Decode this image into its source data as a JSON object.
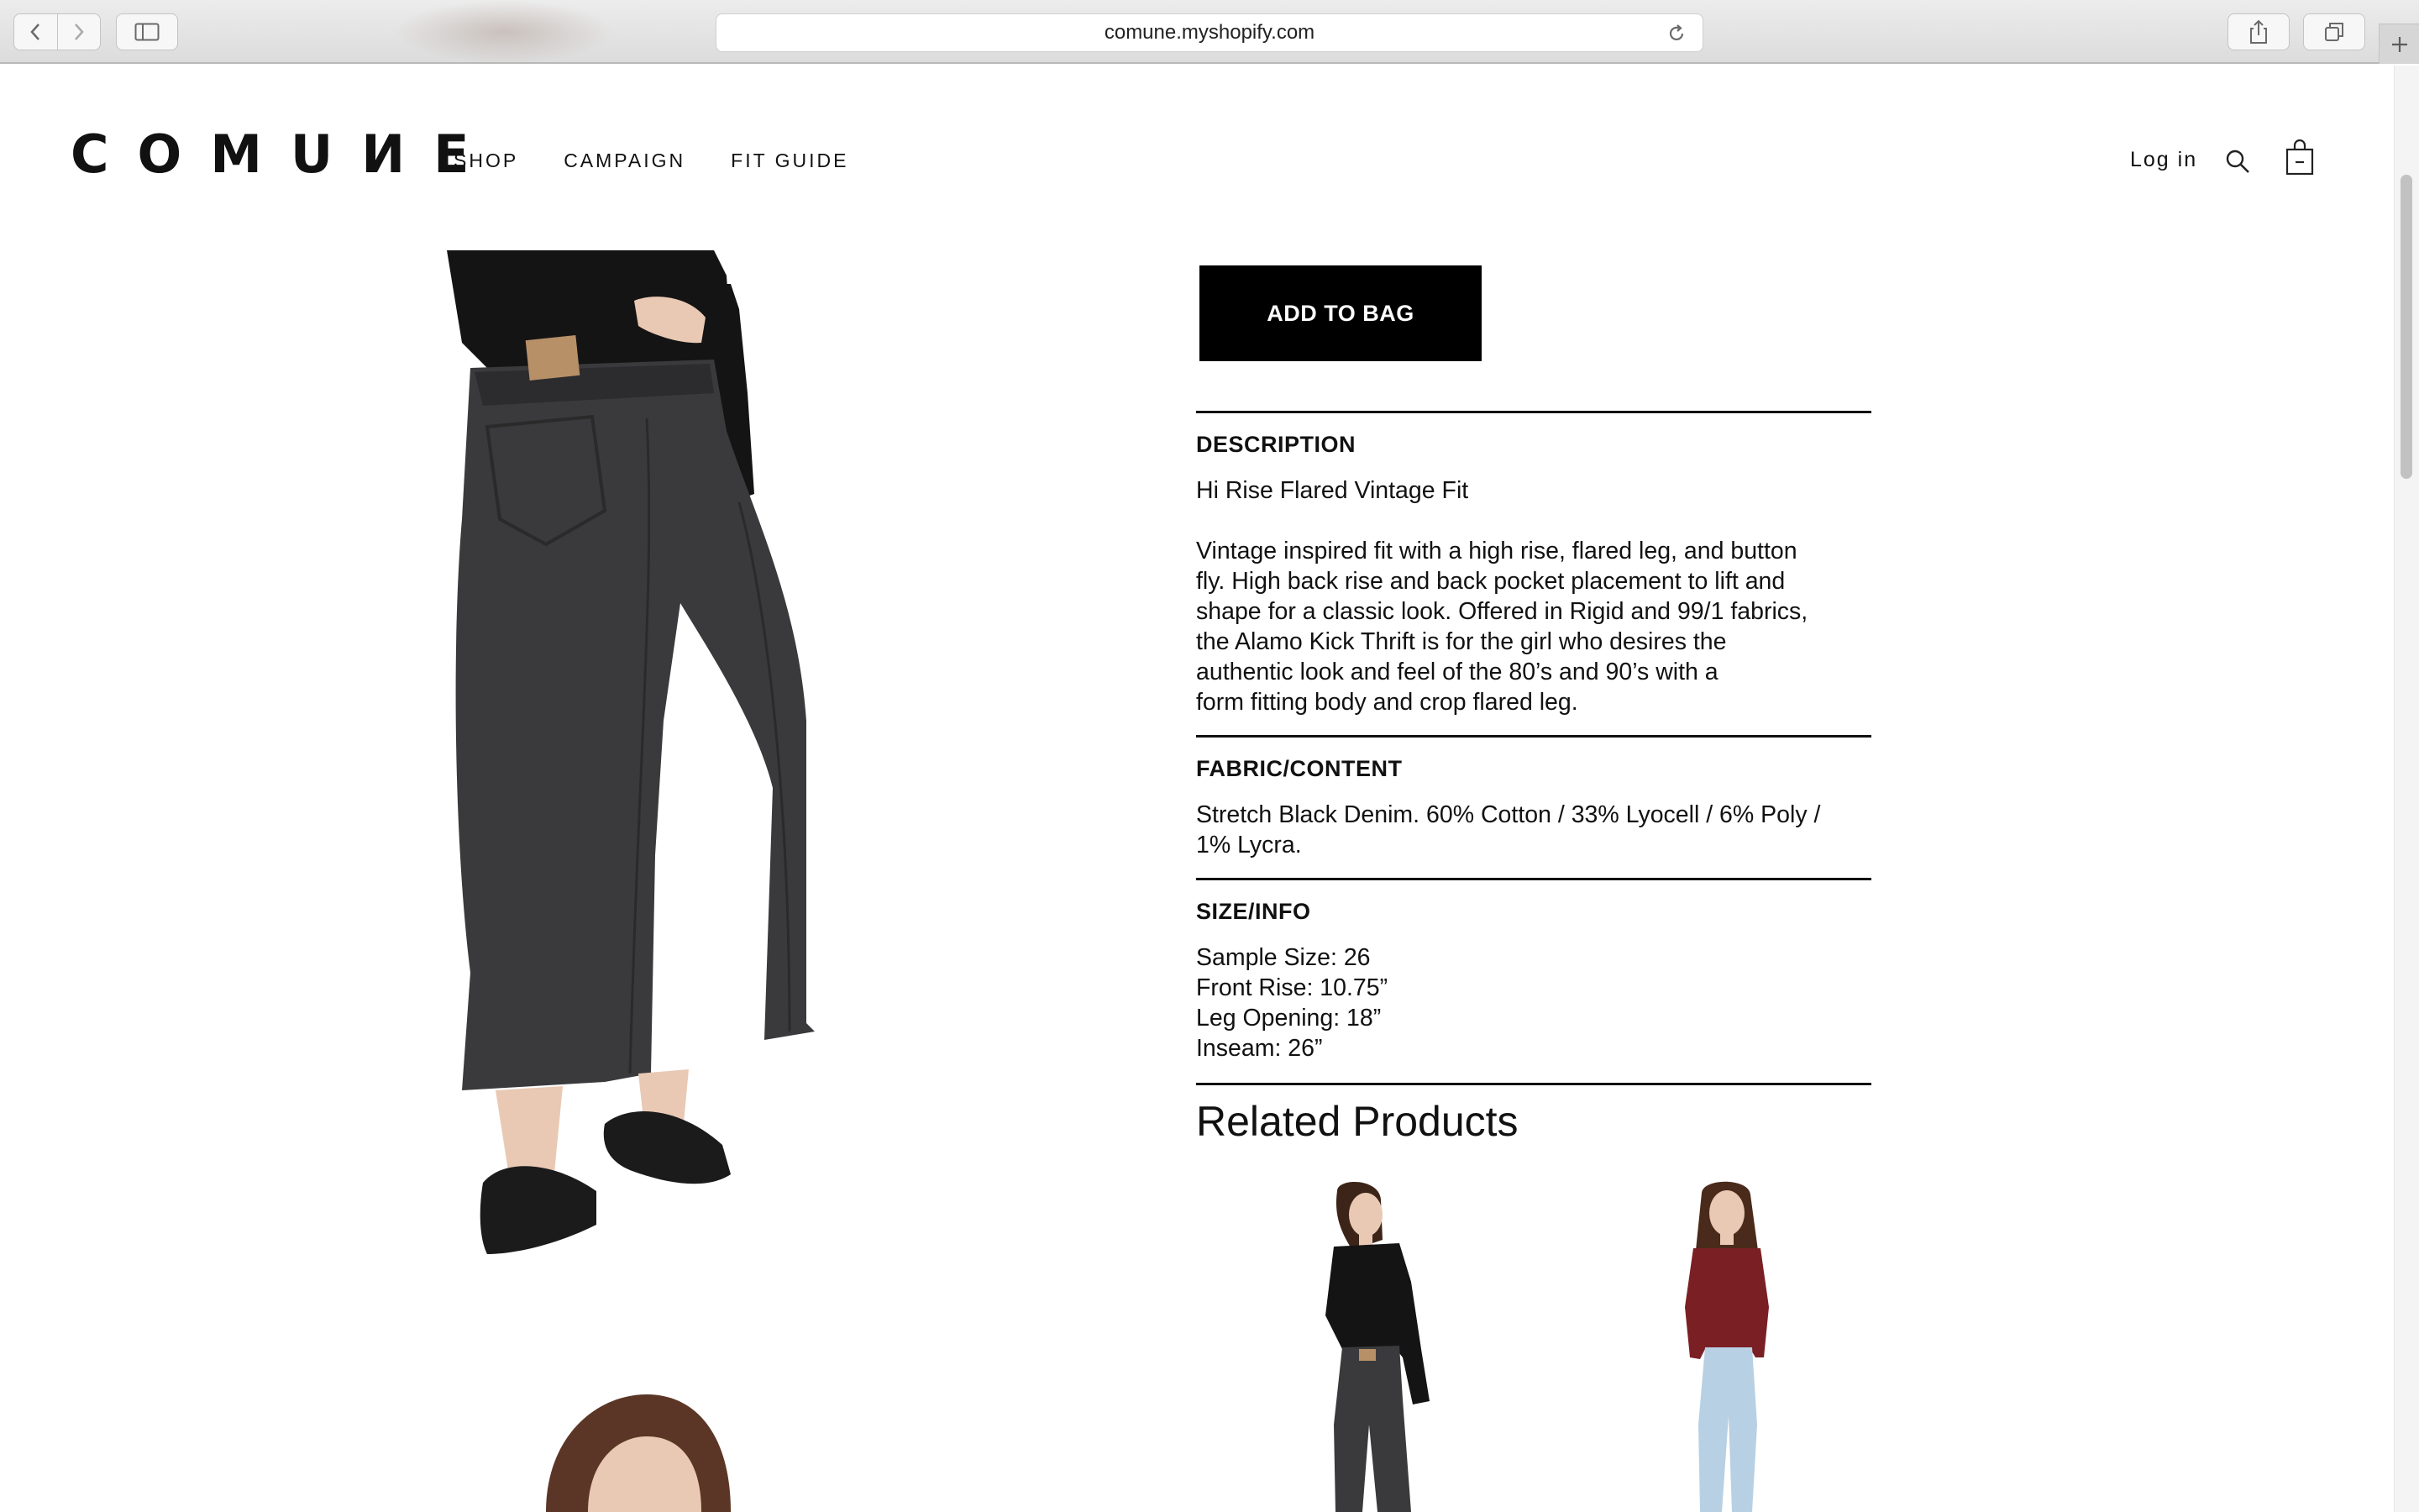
{
  "browser": {
    "url": "comune.myshopify.com"
  },
  "site": {
    "logo": "COMUИE",
    "nav": [
      "SHOP",
      "CAMPAIGN",
      "FIT GUIDE"
    ],
    "account_link": "Log in"
  },
  "product": {
    "add_to_bag": "ADD TO BAG",
    "description": {
      "title": "DESCRIPTION",
      "subtitle": "Hi Rise Flared Vintage Fit",
      "lines": [
        "Vintage inspired fit with a high rise, flared leg, and button",
        "fly. High back rise and back pocket placement to lift and",
        "shape for a classic look. Offered in Rigid and 99/1 fabrics,",
        "the Alamo Kick Thrift is for the girl who desires the",
        "authentic look and feel of the 80’s and 90’s with a",
        "form fitting body and crop flared leg."
      ]
    },
    "fabric": {
      "title": "FABRIC/CONTENT",
      "lines": [
        "Stretch Black Denim. 60% Cotton / 33% Lyocell / 6% Poly /",
        "1% Lycra."
      ]
    },
    "size": {
      "title": "SIZE/INFO",
      "lines": [
        "Sample Size: 26",
        "Front Rise: 10.75”",
        "Leg Opening: 18”",
        "Inseam: 26”"
      ]
    },
    "related_heading": "Related Products"
  },
  "colors": {
    "accent": "#000000",
    "denim": "#3a3a3c",
    "top_black": "#141414",
    "burgundy": "#7a1f24",
    "light_denim": "#b8d0e3",
    "skin": "#e9c9b4"
  }
}
